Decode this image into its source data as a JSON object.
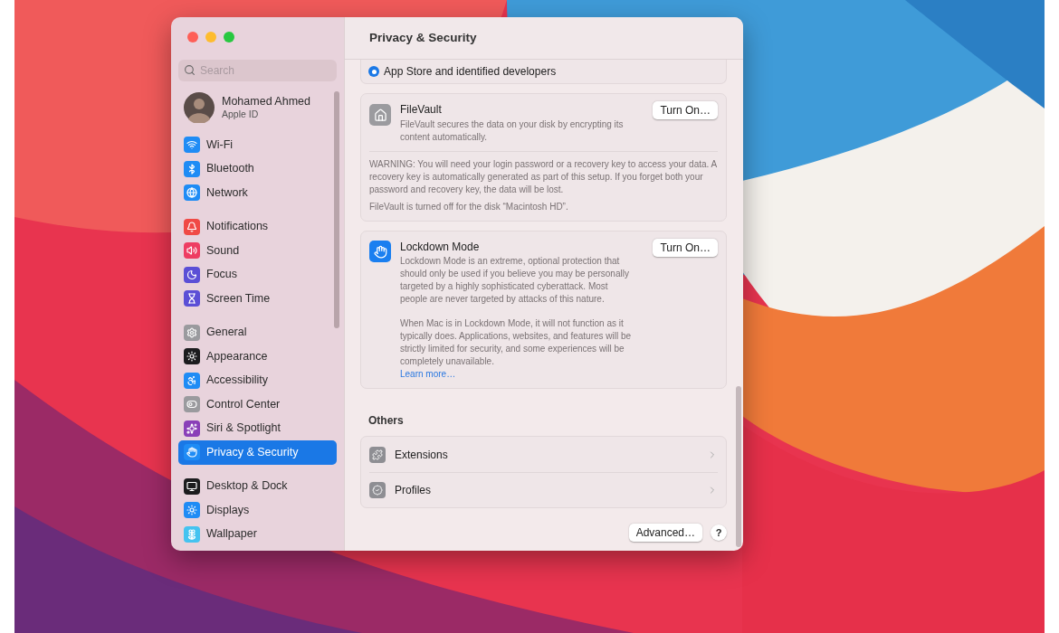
{
  "window": {
    "title": "Privacy & Security"
  },
  "sidebar": {
    "search": {
      "placeholder": "Search"
    },
    "account": {
      "name": "Mohamed Ahmed",
      "subtitle": "Apple ID"
    },
    "groups": [
      {
        "items": [
          {
            "label": "Wi-Fi",
            "color": "#1f8cf5",
            "selected": false
          },
          {
            "label": "Bluetooth",
            "color": "#1f8cf5",
            "selected": false
          },
          {
            "label": "Network",
            "color": "#1f8cf5",
            "selected": false
          }
        ]
      },
      {
        "items": [
          {
            "label": "Notifications",
            "color": "#f04a45",
            "selected": false
          },
          {
            "label": "Sound",
            "color": "#ee3d62",
            "selected": false
          },
          {
            "label": "Focus",
            "color": "#5b4fd6",
            "selected": false
          },
          {
            "label": "Screen Time",
            "color": "#5b4fd6",
            "selected": false
          }
        ]
      },
      {
        "items": [
          {
            "label": "General",
            "color": "#9a9a9e",
            "selected": false
          },
          {
            "label": "Appearance",
            "color": "#1c1c1e",
            "selected": false
          },
          {
            "label": "Accessibility",
            "color": "#1f8cf5",
            "selected": false
          },
          {
            "label": "Control Center",
            "color": "#9a9a9e",
            "selected": false
          },
          {
            "label": "Siri & Spotlight",
            "color": "#8a3fb8",
            "selected": false
          },
          {
            "label": "Privacy & Security",
            "color": "#1f8cf5",
            "selected": true
          }
        ]
      },
      {
        "items": [
          {
            "label": "Desktop & Dock",
            "color": "#1c1c1e",
            "selected": false
          },
          {
            "label": "Displays",
            "color": "#1f8cf5",
            "selected": false
          },
          {
            "label": "Wallpaper",
            "color": "#45c3f0",
            "selected": false
          }
        ]
      }
    ]
  },
  "content": {
    "radio_option": {
      "label": "App Store and identified developers",
      "selected": true
    },
    "filevault": {
      "title": "FileVault",
      "description": "FileVault secures the data on your disk by encrypting its content automatically.",
      "button": "Turn On…",
      "warning": "WARNING: You will need your login password or a recovery key to access your data. A recovery key is automatically generated as part of this setup. If you forget both your password and recovery key, the data will be lost.",
      "status": "FileVault is turned off for the disk “Macintosh HD”."
    },
    "lockdown": {
      "title": "Lockdown Mode",
      "paragraphs": [
        "Lockdown Mode is an extreme, optional protection that should only be used if you believe you may be personally targeted by a highly sophisticated cyberattack. Most people are never targeted by attacks of this nature.",
        "When Mac is in Lockdown Mode, it will not function as it typically does. Applications, websites, and features will be strictly limited for security, and some experiences will be completely unavailable."
      ],
      "link": "Learn more…",
      "button": "Turn On…"
    },
    "others": {
      "heading": "Others",
      "rows": [
        {
          "label": "Extensions",
          "kind": "extensions"
        },
        {
          "label": "Profiles",
          "kind": "profiles"
        }
      ]
    },
    "footer": {
      "advanced_button": "Advanced…",
      "help_button": "?"
    }
  }
}
